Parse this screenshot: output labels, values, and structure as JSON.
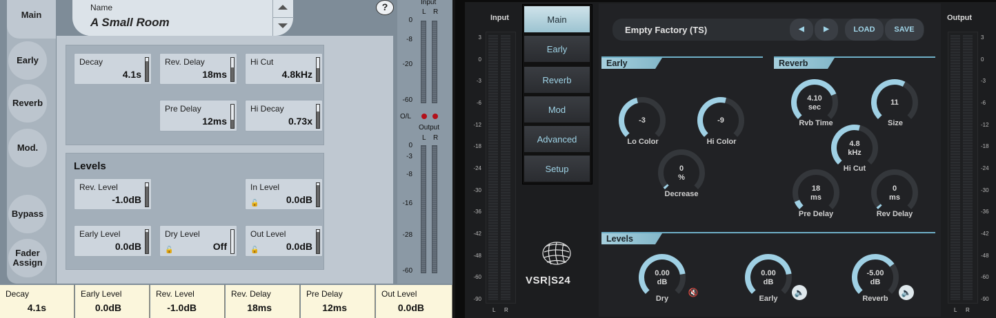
{
  "left": {
    "tabs": [
      "Main",
      "Early",
      "Reverb",
      "Mod.",
      "Bypass",
      "Fader\nAssign"
    ],
    "name": {
      "label": "Name",
      "value": "A Small Room"
    },
    "help": "?",
    "params_top": [
      {
        "label": "Decay",
        "value": "4.1s",
        "level": 0.85
      },
      {
        "label": "Rev. Delay",
        "value": "18ms",
        "level": 0.6
      },
      {
        "label": "Hi Cut",
        "value": "4.8kHz",
        "level": 0.55
      },
      {
        "label": "Pre Delay",
        "value": "12ms",
        "level": 0.35
      },
      {
        "label": "Hi Decay",
        "value": "0.73x",
        "level": 0.7
      }
    ],
    "levels_title": "Levels",
    "params_levels": [
      {
        "label": "Rev. Level",
        "value": "-1.0dB",
        "level": 0.85
      },
      {
        "label": "In Level",
        "value": "0.0dB",
        "level": 0.9
      },
      {
        "label": "Early Level",
        "value": "0.0dB",
        "level": 0.9
      },
      {
        "label": "Dry Level",
        "value": "Off",
        "level": 0.0
      },
      {
        "label": "Out Level",
        "value": "0.0dB",
        "level": 0.9
      }
    ],
    "input_meter": {
      "title": "Input",
      "channels": [
        "L",
        "R"
      ],
      "scale": [
        "0",
        "-8",
        "-20",
        "-60"
      ]
    },
    "ol_label": "O/L",
    "output_meter": {
      "title": "Output",
      "channels": [
        "L",
        "R"
      ],
      "scale": [
        "0",
        "-3",
        "-8",
        "-16",
        "-28",
        "-60"
      ]
    },
    "status_bar": [
      {
        "label": "Decay",
        "value": "4.1s"
      },
      {
        "label": "Early Level",
        "value": "0.0dB"
      },
      {
        "label": "Rev. Level",
        "value": "-1.0dB"
      },
      {
        "label": "Rev. Delay",
        "value": "18ms"
      },
      {
        "label": "Pre Delay",
        "value": "12ms"
      },
      {
        "label": "Out Level",
        "value": "0.0dB"
      }
    ]
  },
  "right": {
    "input_title": "Input",
    "output_title": "Output",
    "meter_scale": [
      "3",
      "0",
      "-3",
      "-6",
      "-12",
      "-18",
      "-24",
      "-30",
      "-36",
      "-42",
      "-48",
      "-60",
      "-90"
    ],
    "meter_channels": [
      "L",
      "R"
    ],
    "tabs": [
      "Main",
      "Early",
      "Reverb",
      "Mod",
      "Advanced",
      "Setup"
    ],
    "preset": {
      "name": "Empty Factory (TS)",
      "prev": "◀",
      "next": "▶",
      "load": "LOAD",
      "save": "SAVE"
    },
    "early_title": "Early",
    "reverb_title": "Reverb",
    "levels_title": "Levels",
    "knobs": {
      "lo_color": {
        "value": "-3",
        "unit": "",
        "label": "Lo Color",
        "level": 0.45
      },
      "hi_color": {
        "value": "-9",
        "unit": "",
        "label": "Hi Color",
        "level": 0.55
      },
      "decrease": {
        "value": "0",
        "unit": "%",
        "label": "Decrease",
        "level": 0.0
      },
      "rvb_time": {
        "value": "4.10",
        "unit": "sec",
        "label": "Rvb Time",
        "level": 0.75
      },
      "size": {
        "value": "11",
        "unit": "",
        "label": "Size",
        "level": 0.6
      },
      "hi_cut": {
        "value": "4.8",
        "unit": "kHz",
        "label": "Hi Cut",
        "level": 0.55
      },
      "pre_delay": {
        "value": "18",
        "unit": "ms",
        "label": "Pre Delay",
        "level": 0.08
      },
      "rev_delay": {
        "value": "0",
        "unit": "ms",
        "label": "Rev Delay",
        "level": 0.0
      },
      "dry": {
        "value": "0.00",
        "unit": "dB",
        "label": "Dry",
        "level": 0.8
      },
      "early": {
        "value": "0.00",
        "unit": "dB",
        "label": "Early",
        "level": 0.8
      },
      "reverb": {
        "value": "-5.00",
        "unit": "dB",
        "label": "Reverb",
        "level": 0.7
      }
    },
    "logo": "VSR|S24"
  }
}
